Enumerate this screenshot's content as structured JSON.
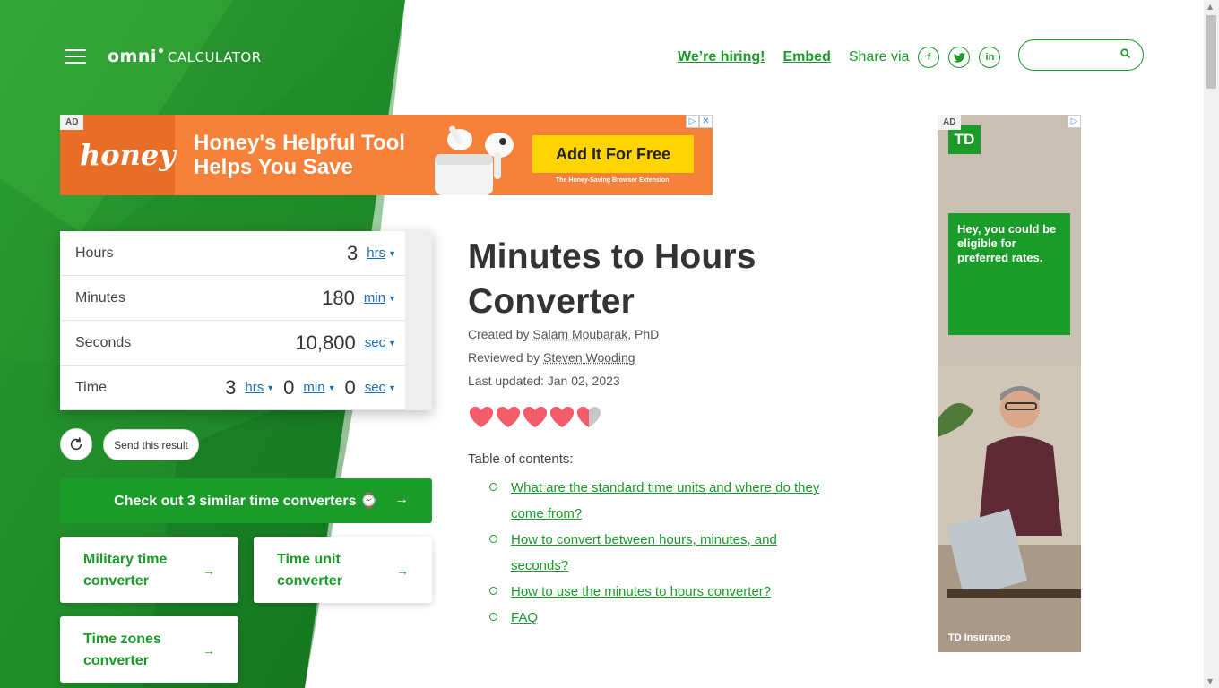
{
  "header": {
    "logo_main": "omni",
    "logo_sub": "CALCULATOR",
    "nav": [
      "We’re hiring!",
      "Embed"
    ],
    "share_label": "Share via",
    "share_icons": [
      "facebook-icon",
      "twitter-icon",
      "linkedin-icon"
    ],
    "search_placeholder": ""
  },
  "ad_banner": {
    "tag": "AD",
    "brand": "honey",
    "headline_1": "Honey's Helpful Tool",
    "headline_2": "Helps You Save",
    "cta": "Add It For Free",
    "small": "The Honey-Saving Browser Extension"
  },
  "ad_side": {
    "tag": "AD",
    "logo": "TD",
    "message": "Hey, you could be eligible for preferred rates.",
    "footer": "TD Insurance"
  },
  "calculator": {
    "rows": [
      {
        "label": "Hours",
        "value": "3",
        "unit": "hrs"
      },
      {
        "label": "Minutes",
        "value": "180",
        "unit": "min"
      },
      {
        "label": "Seconds",
        "value": "10,800",
        "unit": "sec"
      }
    ],
    "time_row": {
      "label": "Time",
      "hours": "3",
      "hours_unit": "hrs",
      "minutes": "0",
      "minutes_unit": "min",
      "seconds": "0",
      "seconds_unit": "sec"
    },
    "send_label": "Send this result"
  },
  "similar": {
    "button_label": "Check out 3 similar time converters ⌚",
    "cards": [
      "Military time converter",
      "Time unit converter",
      "Time zones converter"
    ]
  },
  "article": {
    "title": "Minutes to Hours Converter",
    "created_prefix": "Created by",
    "author": "Salam Moubarak",
    "author_suffix": ", PhD",
    "reviewed_prefix": "Reviewed by",
    "reviewer": "Steven Wooding",
    "updated": "Last updated: Jan 02, 2023",
    "rating": 4.5,
    "toc_label": "Table of contents:",
    "toc": [
      "What are the standard time units and where do they come from?",
      "How to convert between hours, minutes, and seconds?",
      "How to use the minutes to hours converter?",
      "FAQ"
    ]
  },
  "colors": {
    "brand_green": "#1a9b2a",
    "link_blue": "#1c6fb6",
    "heart": "#f25c6b",
    "ad_orange": "#f5813a",
    "ad_yellow": "#ffd400"
  }
}
